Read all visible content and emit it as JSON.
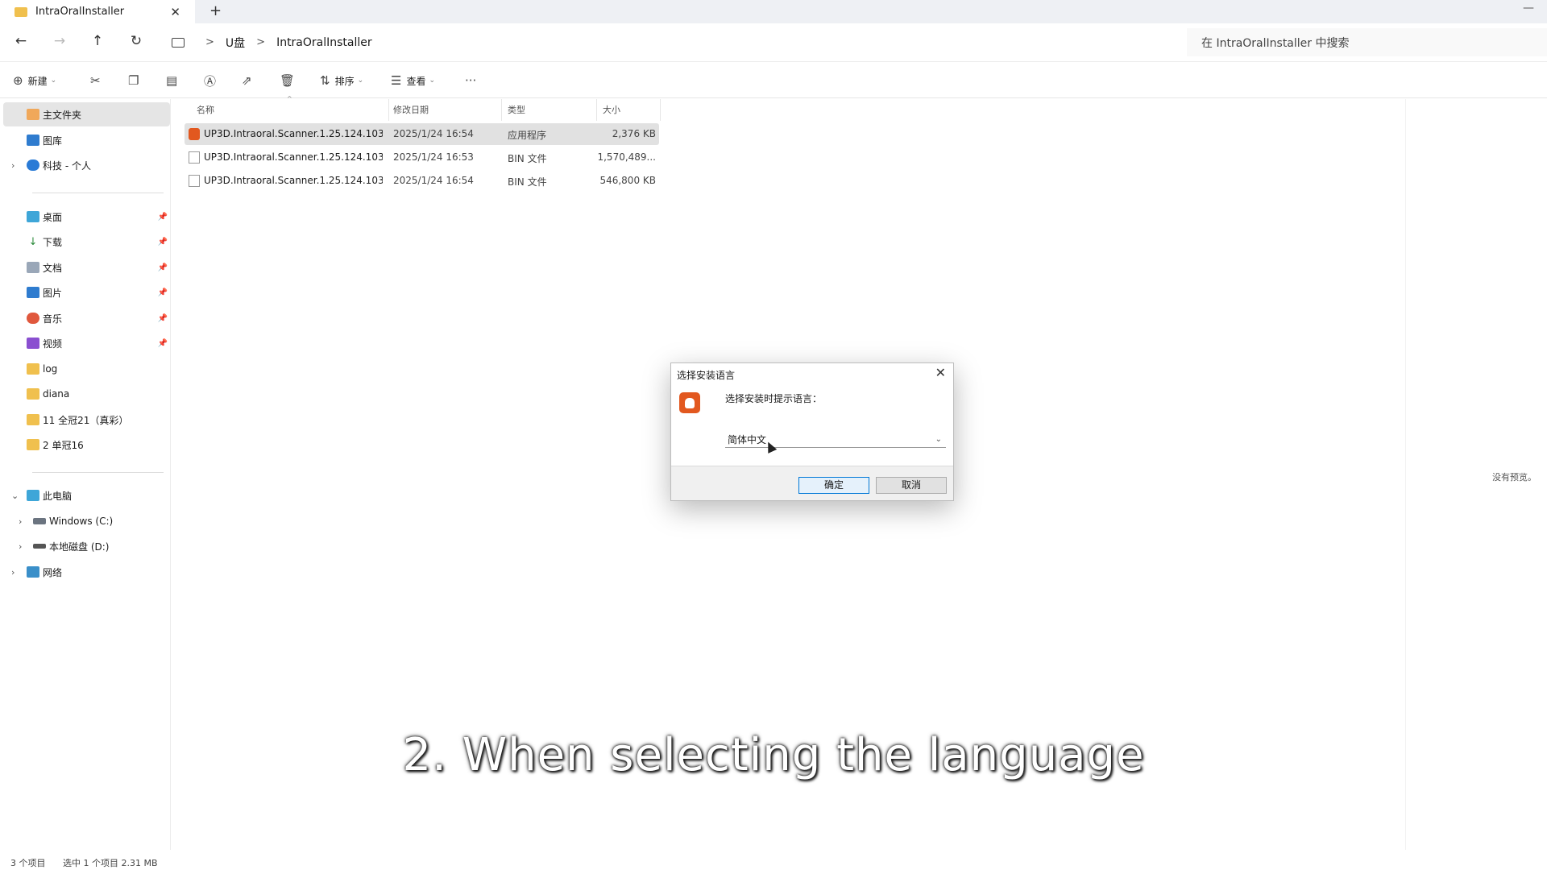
{
  "tab": {
    "title": "IntraOralInstaller",
    "close": "✕",
    "add": "+"
  },
  "window": {
    "minimize": "—"
  },
  "nav": {
    "back": "←",
    "forward": "→",
    "up": "↑",
    "refresh": "↻"
  },
  "breadcrumb": {
    "sep": ">",
    "items": [
      "U盘",
      "IntraOralInstaller"
    ]
  },
  "search": {
    "placeholder": "在 IntraOralInstaller 中搜索"
  },
  "toolbar": {
    "new_label": "新建",
    "sort_label": "排序",
    "view_label": "查看",
    "more": "···"
  },
  "sidebar": {
    "top": [
      {
        "label": "主文件夹",
        "icon": "home-icon"
      },
      {
        "label": "图库",
        "icon": "gallery-icon"
      },
      {
        "label": "科技 - 个人",
        "icon": "cloud-icon"
      }
    ],
    "quick": [
      {
        "label": "桌面",
        "icon": "desktop-icon"
      },
      {
        "label": "下载",
        "icon": "download-icon"
      },
      {
        "label": "文档",
        "icon": "document-icon"
      },
      {
        "label": "图片",
        "icon": "pictures-icon"
      },
      {
        "label": "音乐",
        "icon": "music-icon"
      },
      {
        "label": "视频",
        "icon": "video-icon"
      },
      {
        "label": "log",
        "icon": "folder-icon"
      },
      {
        "label": "diana",
        "icon": "folder-icon"
      },
      {
        "label": "11  全冠21（真彩）",
        "icon": "folder-icon"
      },
      {
        "label": "2   单冠16",
        "icon": "folder-icon"
      }
    ],
    "pc": [
      {
        "label": "此电脑",
        "icon": "this-pc-icon"
      },
      {
        "label": "Windows (C:)",
        "icon": "drive-icon"
      },
      {
        "label": "本地磁盘 (D:)",
        "icon": "drive-icon"
      },
      {
        "label": "网络",
        "icon": "network-icon"
      }
    ]
  },
  "columns": {
    "name": "名称",
    "date": "修改日期",
    "type": "类型",
    "size": "大小"
  },
  "files": [
    {
      "name": "UP3D.Intraoral.Scanner.1.25.124.103...",
      "date": "2025/1/24 16:54",
      "type": "应用程序",
      "size": "2,376 KB"
    },
    {
      "name": "UP3D.Intraoral.Scanner.1.25.124.103...",
      "date": "2025/1/24 16:53",
      "type": "BIN 文件",
      "size": "1,570,489..."
    },
    {
      "name": "UP3D.Intraoral.Scanner.1.25.124.103...",
      "date": "2025/1/24 16:54",
      "type": "BIN 文件",
      "size": "546,800 KB"
    }
  ],
  "preview": {
    "text": "没有预览。"
  },
  "dialog": {
    "title": "选择安装语言",
    "prompt": "选择安装时提示语言：",
    "selected_language": "简体中文",
    "ok_label": "确定",
    "cancel_label": "取消",
    "close": "✕"
  },
  "status": {
    "count": "3 个项目",
    "selection": "选中 1 个项目  2.31 MB"
  },
  "caption": {
    "text": "2. When selecting the language"
  },
  "colors": {
    "accent": "#0078d7",
    "app_icon": "#e2581f",
    "selection": "#e1e1e1"
  }
}
